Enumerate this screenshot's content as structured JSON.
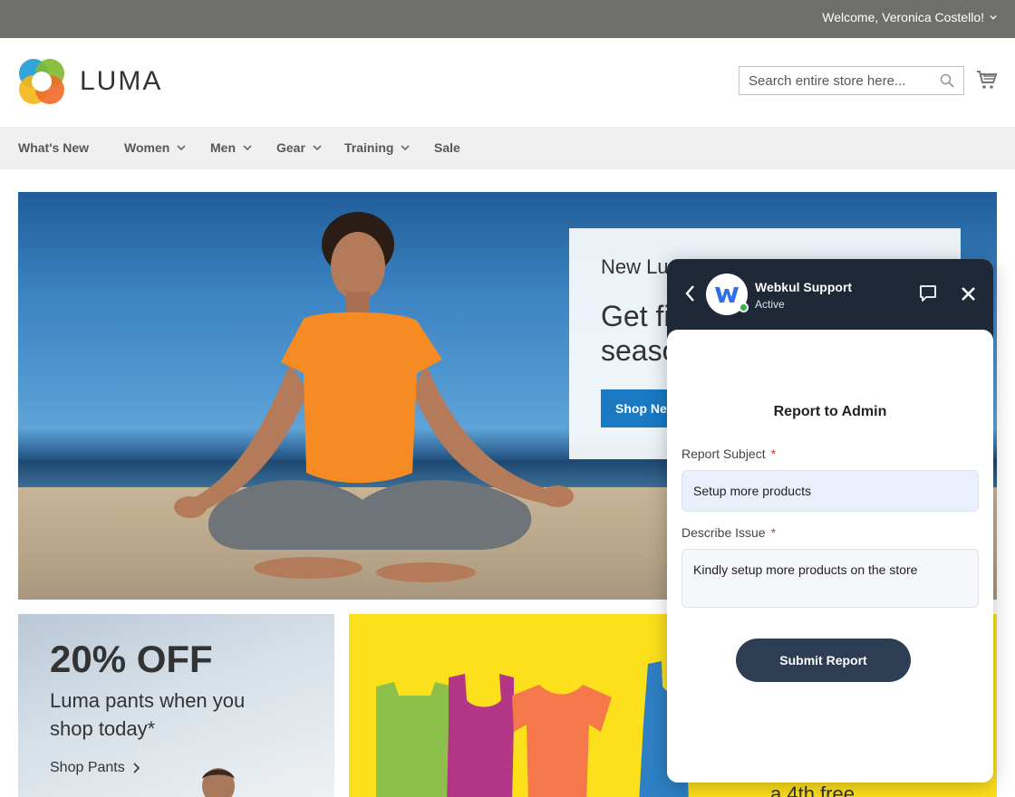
{
  "topbar": {
    "welcome": "Welcome, Veronica Costello!"
  },
  "header": {
    "logo_text": "LUMA",
    "search_placeholder": "Search entire store here...",
    "cart_icon": "cart-icon"
  },
  "nav": {
    "items": [
      {
        "label": "What's New",
        "has_dropdown": false
      },
      {
        "label": "Women",
        "has_dropdown": true
      },
      {
        "label": "Men",
        "has_dropdown": true
      },
      {
        "label": "Gear",
        "has_dropdown": true
      },
      {
        "label": "Training",
        "has_dropdown": true
      },
      {
        "label": "Sale",
        "has_dropdown": false
      }
    ]
  },
  "hero": {
    "subtitle": "New Luma Yoga Collection",
    "title": "Get fit and look fab in new seasonal styles",
    "button": "Shop New Yoga"
  },
  "banner_left": {
    "headline": "20% OFF",
    "text": "Luma pants when you shop today*",
    "link": "Shop Pants"
  },
  "banner_right": {
    "caption": "a 4th free"
  },
  "chat": {
    "agent_name": "Webkul Support",
    "status": "Active",
    "form_title": "Report to Admin",
    "subject_label": "Report Subject",
    "subject_value": "Setup more products",
    "issue_label": "Describe Issue",
    "issue_value": "Kindly setup more products on the store",
    "required_mark": "*",
    "submit_label": "Submit Report",
    "colors": {
      "header": "#1f2837",
      "button": "#2d3d53",
      "online": "#2db24a"
    }
  }
}
